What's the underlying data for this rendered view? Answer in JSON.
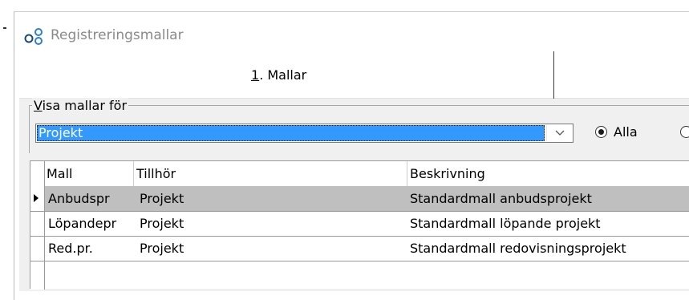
{
  "window": {
    "title": "Registreringsmallar"
  },
  "tabs": [
    {
      "mnemonic": "1",
      "label": ". Mallar"
    }
  ],
  "filter": {
    "legend_mnemonic": "V",
    "legend_rest": "isa mallar för",
    "selected_value": "Projekt",
    "radios": [
      {
        "label": "Alla",
        "checked": true
      },
      {
        "label": "",
        "checked": false
      }
    ]
  },
  "grid": {
    "columns": [
      "Mall",
      "Tillhör",
      "Beskrivning"
    ],
    "rows": [
      {
        "mall": "Anbudspr",
        "tillhor": "Projekt",
        "beskrivning": "Standardmall anbudsprojekt",
        "selected": true
      },
      {
        "mall": "Löpandepr",
        "tillhor": "Projekt",
        "beskrivning": "Standardmall löpande projekt",
        "selected": false
      },
      {
        "mall": "Red.pr.",
        "tillhor": "Projekt",
        "beskrivning": "Standardmall redovisningsprojekt",
        "selected": false
      }
    ]
  },
  "colors": {
    "selection_blue": "#3399ff",
    "row_selected_gray": "#bfbfbf",
    "title_gray": "#8a8a8a"
  },
  "icons": {
    "window": "template-nodes-icon",
    "dropdown": "chevron-down-icon",
    "row_pointer": "row-pointer-icon"
  }
}
